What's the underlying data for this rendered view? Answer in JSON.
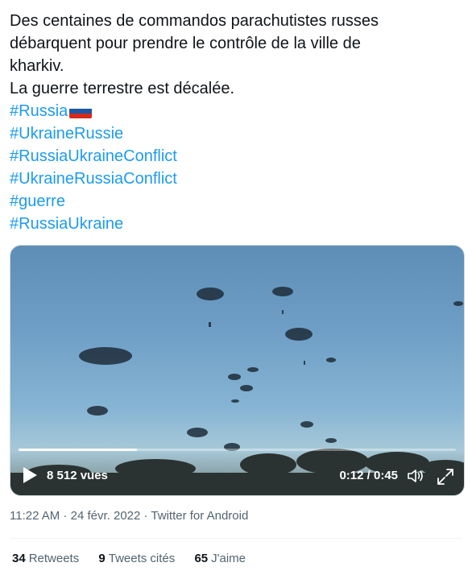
{
  "tweet": {
    "lines": [
      "Des centaines de commandos parachutistes russes",
      "débarquent pour prendre le contrôle de la ville de",
      "kharkiv.",
      "La guerre terrestre est décalée."
    ],
    "hashtags": [
      "#Russia",
      "#UkraineRussie",
      "#RussiaUkraineConflict",
      "#UkraineRussiaConflict",
      "#guerre",
      "#RussiaUkraine"
    ],
    "flag_colors": [
      "#ffffff",
      "#1c57a5",
      "#d52b1e"
    ]
  },
  "video": {
    "views": "8 512 vues",
    "time": "0:12 / 0:45",
    "progress": 0.27
  },
  "meta": {
    "time": "11:22 AM",
    "sep1": " · ",
    "date": "24 févr. 2022",
    "sep2": " · ",
    "source": "Twitter for Android"
  },
  "stats": {
    "retweets_count": "34",
    "retweets_label": "Retweets",
    "quotes_count": "9",
    "quotes_label": "Tweets cités",
    "likes_count": "65",
    "likes_label": "J'aime"
  }
}
